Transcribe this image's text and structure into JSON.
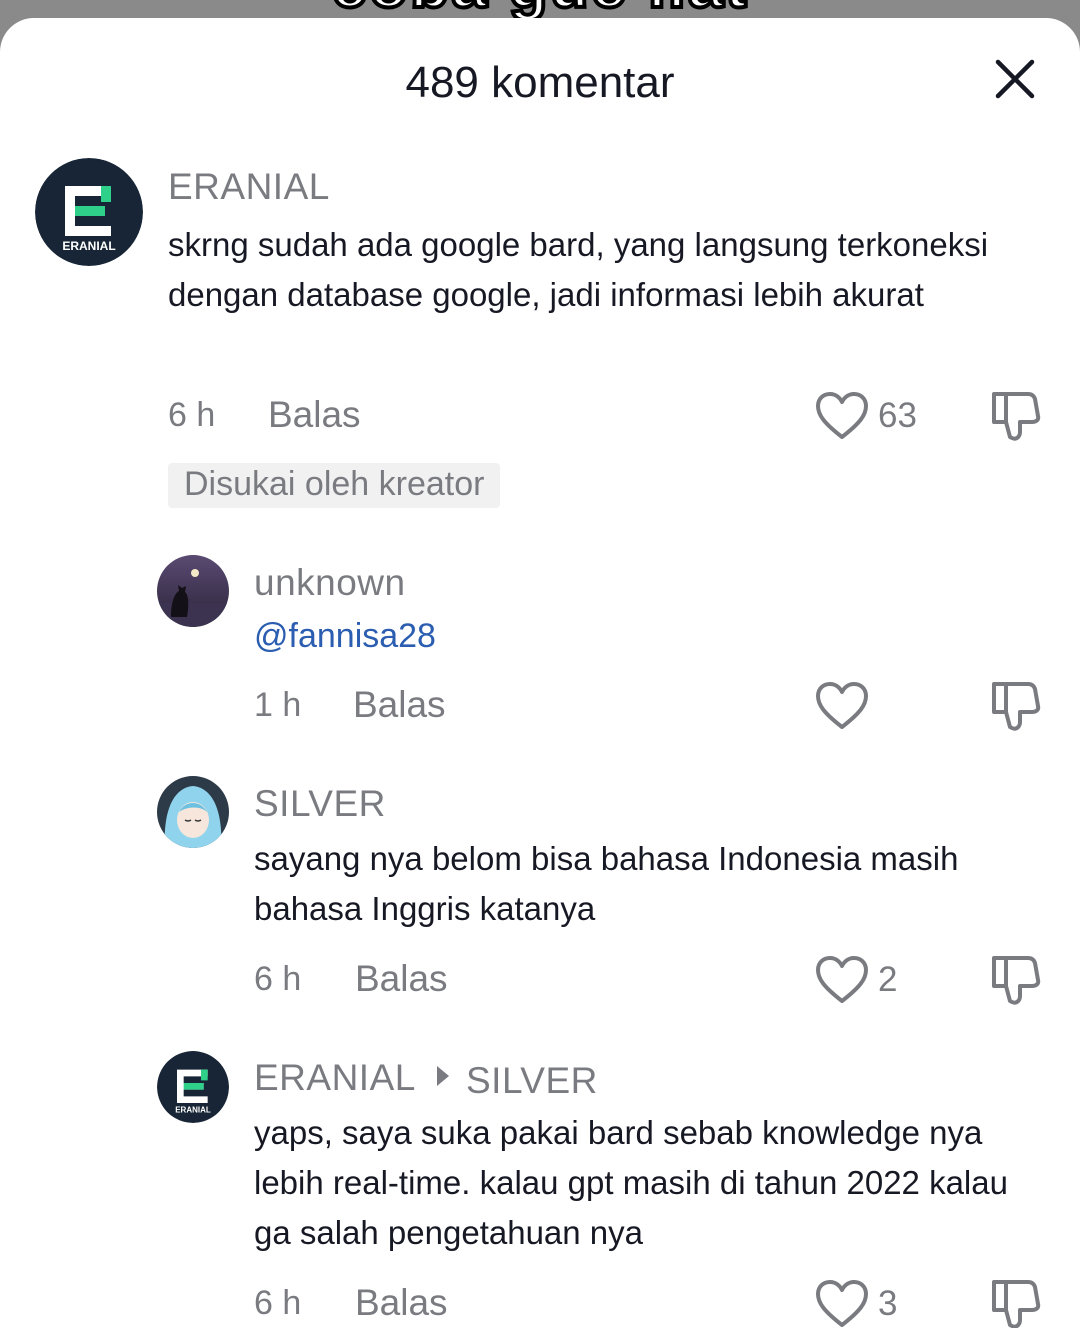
{
  "background": {
    "caption": "coba gue liat"
  },
  "header": {
    "title": "489 komentar",
    "close_icon": "close-icon"
  },
  "colors": {
    "mention": "#2b5db0",
    "muted": "#7a7b80",
    "text": "#161823",
    "badge_bg": "#f1f1f2"
  },
  "comments": [
    {
      "username": "ERANIAL",
      "avatar_text": "ERANIAL",
      "text": "skrng sudah ada google bard, yang langsung terkoneksi dengan database google, jadi informasi lebih akurat",
      "time": "6 h",
      "reply_label": "Balas",
      "likes": "63",
      "badge": "Disukai oleh kreator"
    },
    {
      "username": "unknown",
      "text": "@fannisa28",
      "time": "1 h",
      "reply_label": "Balas",
      "likes": ""
    },
    {
      "username": "SILVER",
      "text": "sayang nya belom bisa bahasa Indonesia masih bahasa Inggris katanya",
      "time": "6 h",
      "reply_label": "Balas",
      "likes": "2"
    },
    {
      "username": "ERANIAL",
      "avatar_text": "ERANIAL",
      "reply_to": "SILVER",
      "text": "yaps, saya suka pakai bard sebab knowledge nya lebih real-time. kalau gpt masih di tahun 2022 kalau ga salah pengetahuan nya",
      "time": "6 h",
      "reply_label": "Balas",
      "likes": "3"
    }
  ]
}
